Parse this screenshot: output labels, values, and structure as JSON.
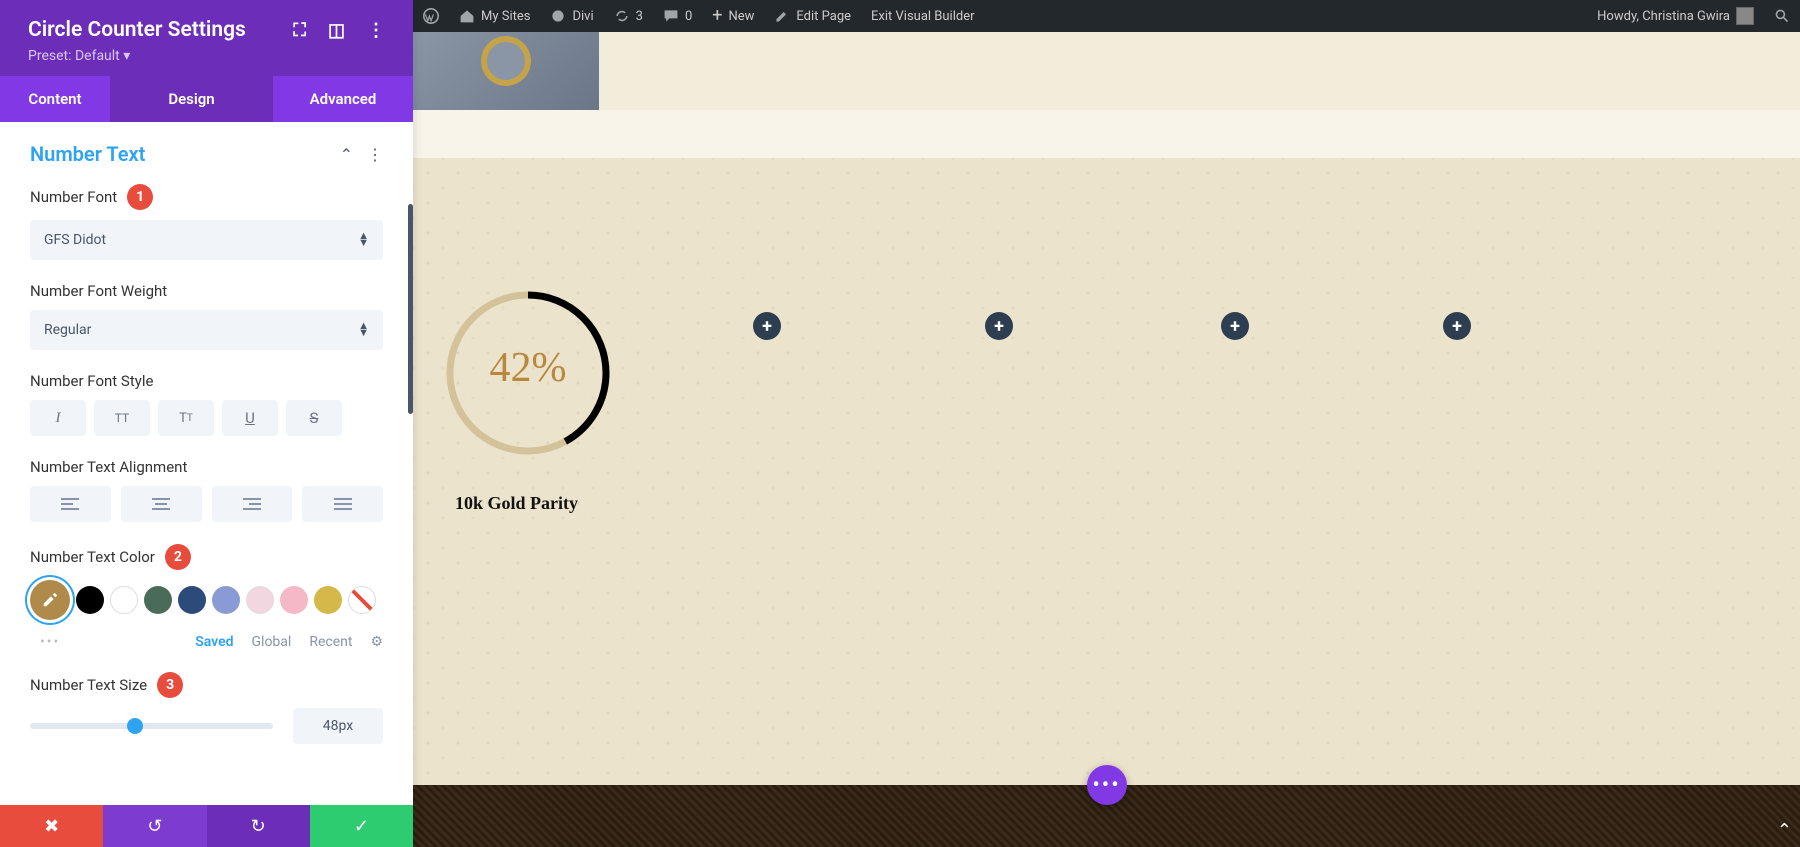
{
  "wp_bar": {
    "my_sites": "My Sites",
    "divi": "Divi",
    "sync": "3",
    "comments": "0",
    "new": "New",
    "edit": "Edit Page",
    "exit": "Exit Visual Builder",
    "howdy": "Howdy, Christina Gwira"
  },
  "panel": {
    "title": "Circle Counter Settings",
    "preset": "Preset: Default ▾",
    "tabs": {
      "content": "Content",
      "design": "Design",
      "advanced": "Advanced"
    },
    "section": "Number Text",
    "labels": {
      "font": "Number Font",
      "weight": "Number Font Weight",
      "style": "Number Font Style",
      "alignment": "Number Text Alignment",
      "color": "Number Text Color",
      "size": "Number Text Size"
    },
    "font_value": "GFS Didot",
    "weight_value": "Regular",
    "size_value": "48px",
    "badges": {
      "font": "1",
      "color": "2",
      "size": "3"
    },
    "color_tabs": {
      "saved": "Saved",
      "global": "Global",
      "recent": "Recent"
    },
    "swatches": [
      "#b08a4a",
      "#000000",
      "#ffffff",
      "#4a6b5a",
      "#2c4a7a",
      "#8a9ad4",
      "#f2d6e0",
      "#f4b8c6",
      "#d4b84a",
      "strike"
    ]
  },
  "canvas": {
    "counter_value": "42%",
    "counter_label": "10k Gold Parity"
  }
}
